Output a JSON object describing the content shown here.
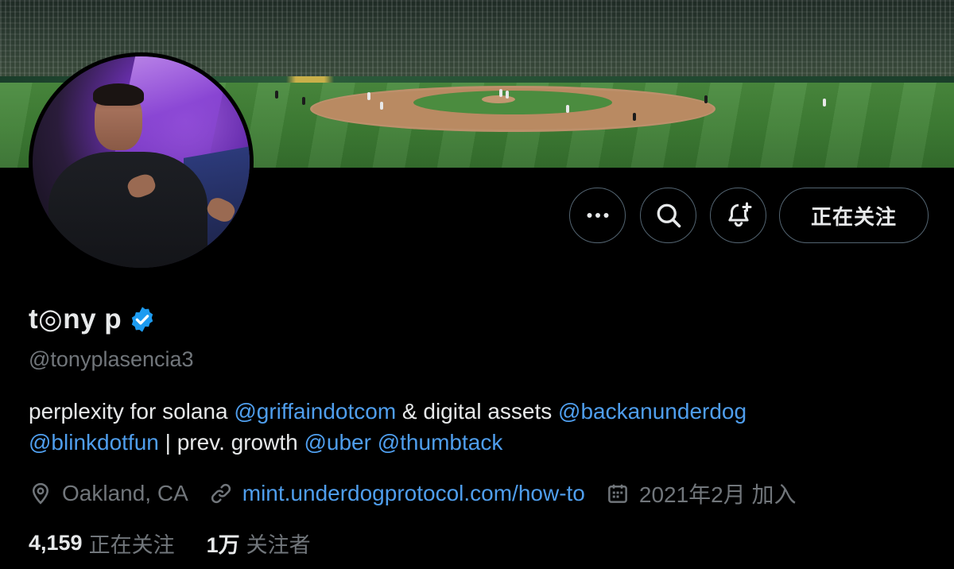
{
  "header": {
    "follow_button": "正在关注"
  },
  "profile": {
    "display_name": "t◎ny p",
    "handle": "@tonyplasencia3",
    "bio": {
      "part1": "perplexity for solana ",
      "mention1": "@griffaindotcom",
      "part2": " & digital assets ",
      "mention2": "@backanunderdog",
      "mention3": "@blinkdotfun",
      "part3": " | prev. growth ",
      "mention4": "@uber",
      "part4": " ",
      "mention5": "@thumbtack"
    },
    "location": "Oakland, CA",
    "website": "mint.underdogprotocol.com/how-to",
    "joined": "2021年2月 加入"
  },
  "stats": {
    "following_count": "4,159",
    "following_label": "正在关注",
    "followers_count": "1万",
    "followers_label": "关注者"
  },
  "icons": {
    "more": "more-icon",
    "search": "search-icon",
    "notify": "bell-plus-icon",
    "verified": "verified-badge-icon",
    "location": "location-pin-icon",
    "link": "link-icon",
    "calendar": "calendar-icon"
  },
  "colors": {
    "link": "#4f9eed",
    "secondary_text": "#71767b",
    "primary_text": "#e7e9ea",
    "verified": "#1d9bf0",
    "border": "#536471"
  }
}
